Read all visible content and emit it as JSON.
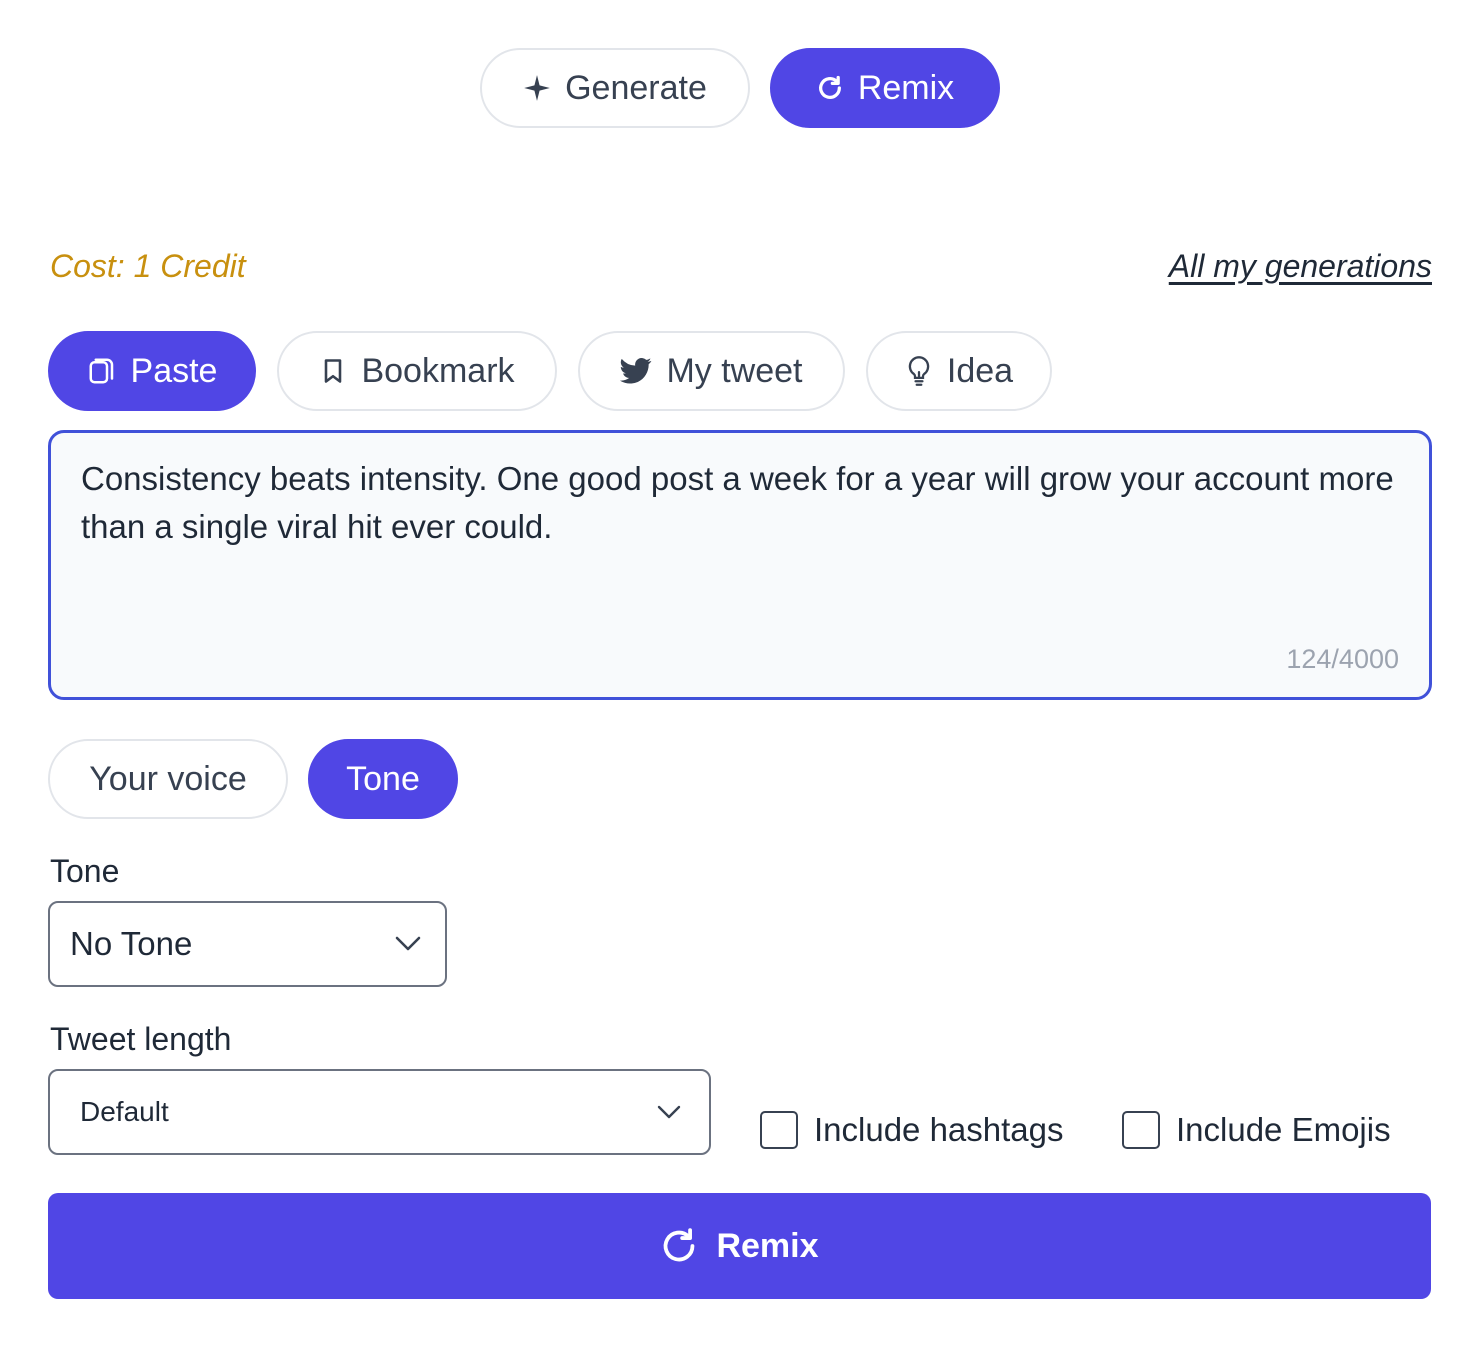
{
  "mode_tabs": {
    "generate": "Generate",
    "remix": "Remix"
  },
  "cost": "Cost: 1 Credit",
  "all_generations_link": "All my generations",
  "source_tabs": {
    "paste": "Paste",
    "bookmark": "Bookmark",
    "my_tweet": "My tweet",
    "idea": "Idea"
  },
  "editor": {
    "text": "Consistency beats intensity. One good post a week for a year will grow your account more than a single viral hit ever could.",
    "char_count": "124/4000"
  },
  "style_tabs": {
    "your_voice": "Your voice",
    "tone": "Tone"
  },
  "tone_field": {
    "label": "Tone",
    "value": "No Tone"
  },
  "length_field": {
    "label": "Tweet length",
    "value": "Default"
  },
  "options": {
    "hashtags": "Include hashtags",
    "emojis": "Include Emojis"
  },
  "submit_button": "Remix",
  "colors": {
    "accent": "#5046e5",
    "cost": "#c8900f",
    "editor_border": "#4051d9"
  }
}
